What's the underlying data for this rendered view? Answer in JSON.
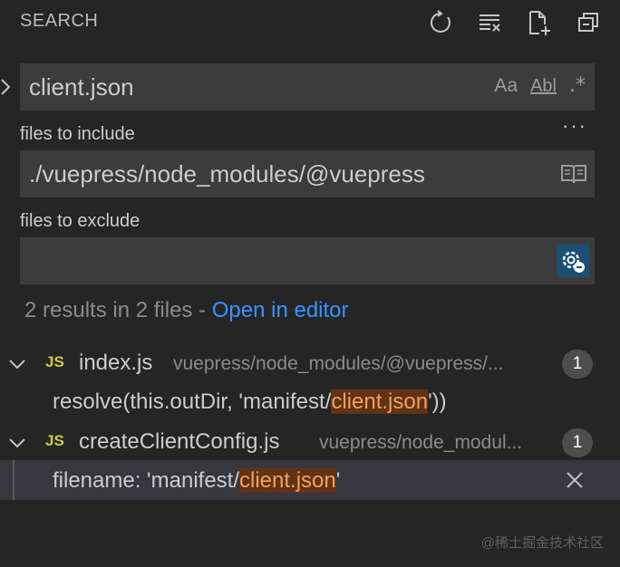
{
  "header": {
    "title": "SEARCH",
    "actions": [
      "refresh-icon",
      "clear-results-icon",
      "new-search-editor-icon",
      "collapse-all-icon"
    ]
  },
  "search": {
    "query": "client.json",
    "toggles": {
      "match_case": "Aa",
      "whole_word": "Abl",
      "regex": ".*"
    },
    "more": "···"
  },
  "include": {
    "label": "files to include",
    "value": "./vuepress/node_modules/@vuepress"
  },
  "exclude": {
    "label": "files to exclude",
    "value": ""
  },
  "summary": {
    "text": "2 results in 2 files - ",
    "link": "Open in editor"
  },
  "results": [
    {
      "icon": "JS",
      "name": "index.js",
      "path": "vuepress/node_modules/@vuepress/...",
      "count": "1",
      "match": {
        "before": "resolve(this.outDir, 'manifest/",
        "hit": "client.json",
        "after": "'))"
      }
    },
    {
      "icon": "JS",
      "name": "createClientConfig.js",
      "path": "vuepress/node_modul...",
      "count": "1",
      "match": {
        "before": "filename: 'manifest/",
        "hit": "client.json",
        "after": "'"
      }
    }
  ],
  "watermark": "@稀土掘金技术社区",
  "colors": {
    "background": "#252526",
    "input": "#3c3c3c",
    "link": "#3794ff",
    "highlight": "#613214",
    "js_icon": "#cbcb41"
  }
}
